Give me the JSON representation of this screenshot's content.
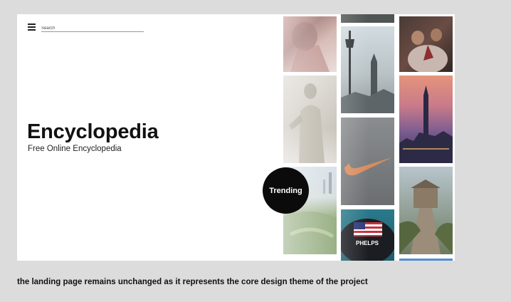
{
  "header": {
    "menu_icon": "hamburger-menu-icon",
    "search_placeholder": "Search"
  },
  "hero": {
    "title": "Encyclopedia",
    "subtitle": "Free Online Encyclopedia"
  },
  "trending_button": {
    "label": "Trending"
  },
  "gallery": {
    "tiles": [
      {
        "name": "sports-player-photo-tile"
      },
      {
        "name": "roman-statue-photo-tile"
      },
      {
        "name": "golf-course-photo-tile"
      },
      {
        "name": "london-street-lamp-big-ben-tile"
      },
      {
        "name": "nike-logo-tile"
      },
      {
        "name": "phelps-swim-cap-tile"
      },
      {
        "name": "wedding-ceremony-photo-tile"
      },
      {
        "name": "city-skyline-sunset-tile"
      },
      {
        "name": "great-wall-photo-tile"
      }
    ],
    "badge_text": "PHELPS"
  },
  "caption": "the landing page remains unchanged as it represents the core design theme of the project"
}
